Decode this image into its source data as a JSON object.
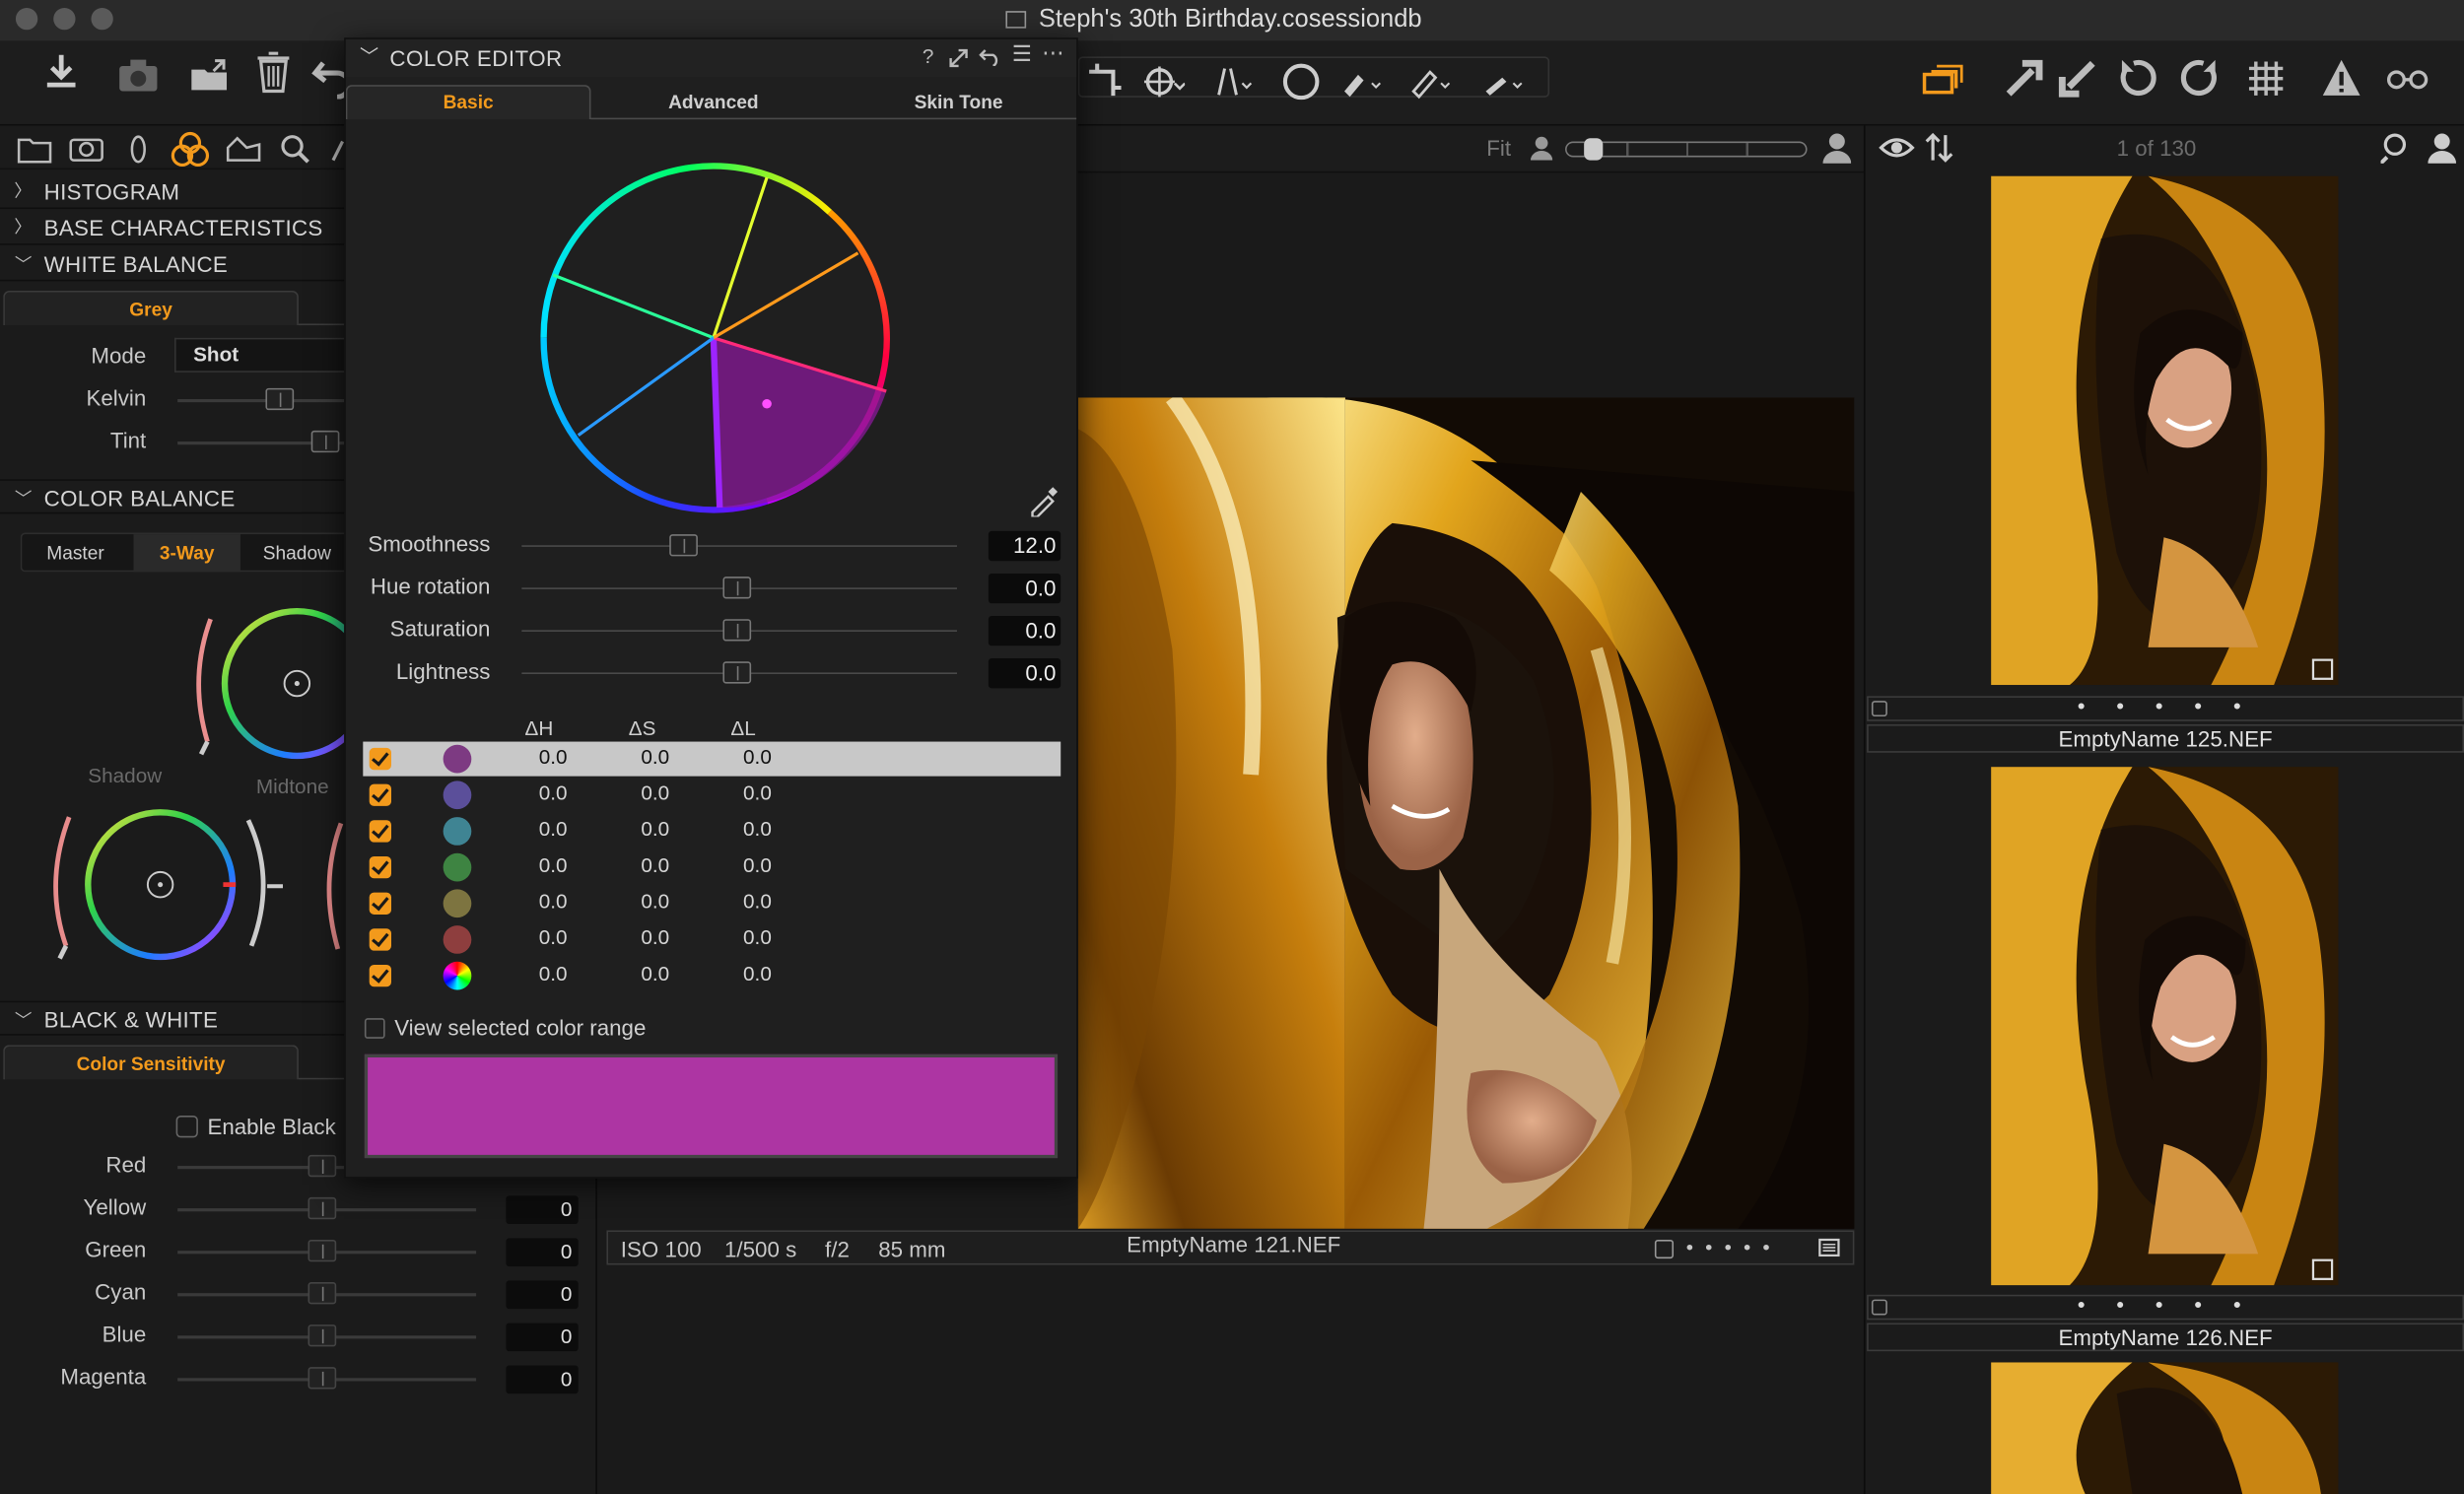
{
  "window": {
    "title": "Steph's 30th Birthday.cosessiondb"
  },
  "colors": {
    "accent": "#f39a1c",
    "selected_color": "#ad35a3",
    "panel_bg": "#1b1b1b",
    "photo_gold": "#d4a017"
  },
  "toolbar": {
    "left_icons": [
      "import-icon",
      "camera-icon",
      "export-folder-icon",
      "trash-icon",
      "undo-icon"
    ],
    "center_icons": [
      "crop-icon",
      "rotate-icon",
      "keystone-icon",
      "spot-circle-icon",
      "brush-icon",
      "eraser-icon",
      "picker-icon"
    ],
    "right_icons": [
      "layers-icon",
      "copy-adjustments-icon",
      "apply-adjustments-icon",
      "reset-icon",
      "redo-icon",
      "grid-icon",
      "warning-icon",
      "glasses-icon"
    ]
  },
  "left_tabs": [
    "folder-icon",
    "camera-tab-icon",
    "lens-icon",
    "color-icon",
    "exposure-icon",
    "search-tab-icon"
  ],
  "histogram": {
    "title": "HISTOGRAM"
  },
  "base_characteristics": {
    "title": "BASE CHARACTERISTICS"
  },
  "white_balance": {
    "title": "WHITE BALANCE",
    "tab": "Grey",
    "mode_label": "Mode",
    "mode_value": "Shot",
    "kelvin_label": "Kelvin",
    "tint_label": "Tint"
  },
  "color_balance": {
    "title": "COLOR BALANCE",
    "tabs": [
      "Master",
      "3-Way",
      "Shadow"
    ],
    "active_tab": "3-Way",
    "shadow_label": "Shadow",
    "midtone_label": "Midtone"
  },
  "black_white": {
    "title": "BLACK & WHITE",
    "tab": "Color Sensitivity",
    "enable_label": "Enable Black",
    "rows": [
      {
        "label": "Red",
        "value": ""
      },
      {
        "label": "Yellow",
        "value": "0"
      },
      {
        "label": "Green",
        "value": "0"
      },
      {
        "label": "Cyan",
        "value": "0"
      },
      {
        "label": "Blue",
        "value": "0"
      },
      {
        "label": "Magenta",
        "value": "0"
      }
    ]
  },
  "color_editor": {
    "title": "COLOR EDITOR",
    "tabs": [
      "Basic",
      "Advanced",
      "Skin Tone"
    ],
    "active_tab": "Basic",
    "sliders": [
      {
        "label": "Smoothness",
        "value": "12.0"
      },
      {
        "label": "Hue rotation",
        "value": "0.0"
      },
      {
        "label": "Saturation",
        "value": "0.0"
      },
      {
        "label": "Lightness",
        "value": "0.0"
      }
    ],
    "table_headers": [
      "ΔH",
      "ΔS",
      "ΔL"
    ],
    "rows": [
      {
        "color": "#7d3a82",
        "dh": "0.0",
        "ds": "0.0",
        "dl": "0.0"
      },
      {
        "color": "#5b4f9a",
        "dh": "0.0",
        "ds": "0.0",
        "dl": "0.0"
      },
      {
        "color": "#3f8493",
        "dh": "0.0",
        "ds": "0.0",
        "dl": "0.0"
      },
      {
        "color": "#3e8442",
        "dh": "0.0",
        "ds": "0.0",
        "dl": "0.0"
      },
      {
        "color": "#7d7440",
        "dh": "0.0",
        "ds": "0.0",
        "dl": "0.0"
      },
      {
        "color": "#8e3e3e",
        "dh": "0.0",
        "ds": "0.0",
        "dl": "0.0"
      },
      {
        "color": "rainbow",
        "dh": "0.0",
        "ds": "0.0",
        "dl": "0.0"
      }
    ],
    "view_range_label": "View selected color range"
  },
  "viewer": {
    "fit_label": "Fit",
    "iso": "ISO 100",
    "shutter": "1/500 s",
    "aperture": "f/2",
    "focal": "85 mm",
    "filename": "EmptyName 121.NEF",
    "rating_dots": "• • • • •"
  },
  "browser": {
    "count": "1 of 130",
    "items": [
      {
        "name": "EmptyName 125.NEF",
        "dots": "• • • • •"
      },
      {
        "name": "EmptyName 126.NEF",
        "dots": "• • • • •"
      }
    ]
  }
}
